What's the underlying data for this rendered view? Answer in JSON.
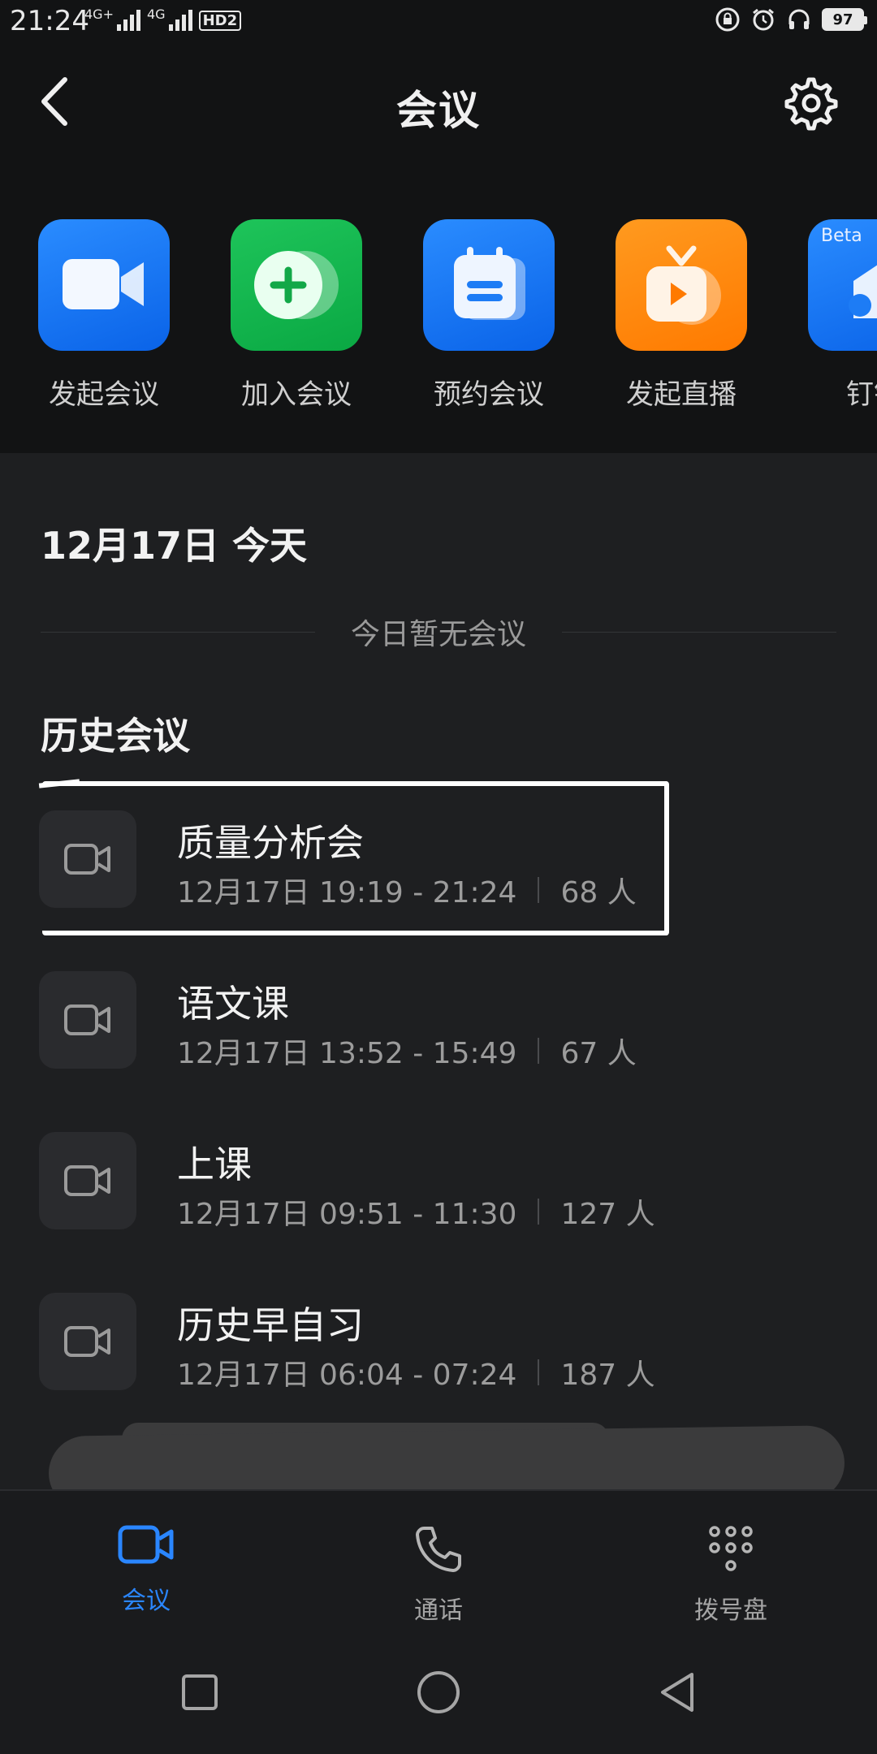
{
  "status_bar": {
    "time": "21:24",
    "network_1": "4G+",
    "network_2": "4G",
    "hd": "HD2",
    "battery": "97"
  },
  "header": {
    "title": "会议"
  },
  "quick_actions": [
    {
      "label": "发起会议",
      "icon": "video-camera-icon",
      "color": "#1d7cf5"
    },
    {
      "label": "加入会议",
      "icon": "plus-circle-icon",
      "color": "#12b64e"
    },
    {
      "label": "预约会议",
      "icon": "calendar-icon",
      "color": "#1d7cf5"
    },
    {
      "label": "发起直播",
      "icon": "tv-play-icon",
      "color": "#ff8a0f"
    },
    {
      "label": "钉钉",
      "icon": "screen-cast-icon",
      "color": "#1d7cf5",
      "badge": "Beta"
    }
  ],
  "today": {
    "date": "12月17日 今天",
    "empty_text": "今日暂无会议"
  },
  "history": {
    "heading": "历史会议",
    "meetings": [
      {
        "title": "质量分析会",
        "time": "12月17日 19:19 - 21:24",
        "count": "68 人"
      },
      {
        "title": "语文课",
        "time": "12月17日 13:52 - 15:49",
        "count": "67 人"
      },
      {
        "title": "上课",
        "time": "12月17日 09:51 - 11:30",
        "count": "127 人"
      },
      {
        "title": "历史早自习",
        "time": "12月17日 06:04 - 07:24",
        "count": "187 人"
      }
    ]
  },
  "tabs": [
    {
      "label": "会议",
      "icon": "video-camera-icon",
      "active": true
    },
    {
      "label": "通话",
      "icon": "phone-icon",
      "active": false
    },
    {
      "label": "拨号盘",
      "icon": "dialpad-icon",
      "active": false
    }
  ],
  "colors": {
    "accent": "#2a86ff",
    "background": "#1e1f21"
  }
}
